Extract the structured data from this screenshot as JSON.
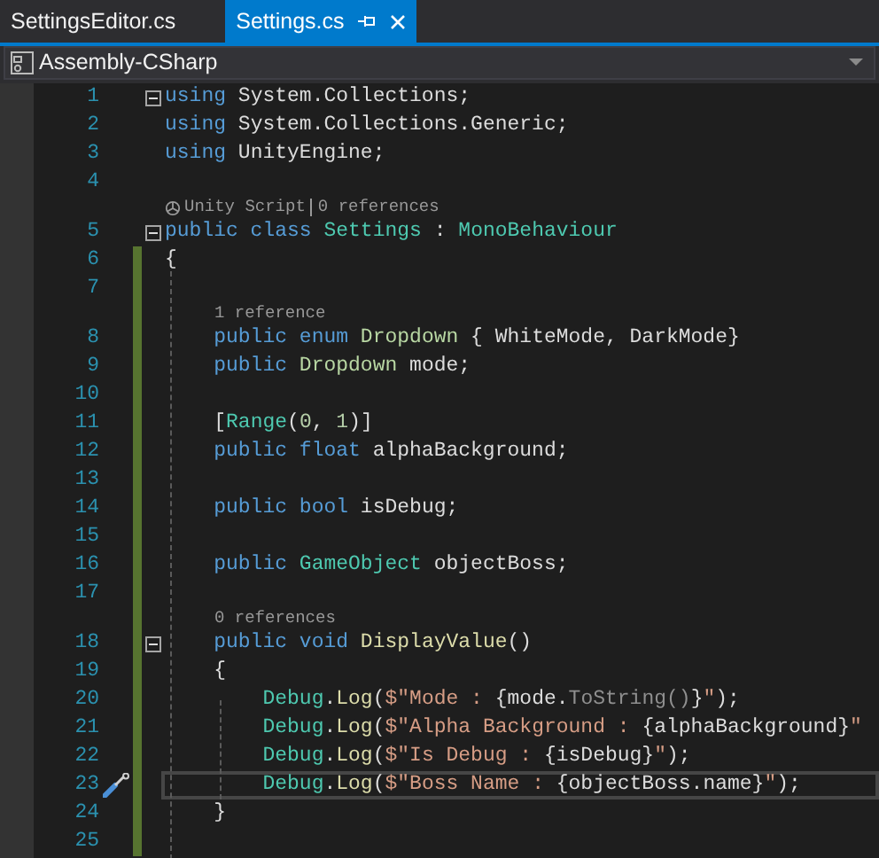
{
  "tabs": [
    {
      "label": "SettingsEditor.cs",
      "selected": false
    },
    {
      "label": "Settings.cs",
      "selected": true
    }
  ],
  "project_dropdown": {
    "value": "Assembly-CSharp"
  },
  "editor": {
    "lines": [
      {
        "number": "1",
        "fold": true,
        "changed": false,
        "current": false,
        "tokens": [
          {
            "kind": "kw",
            "text": "using"
          },
          {
            "kind": "plain",
            "text": " System.Collections;"
          }
        ]
      },
      {
        "number": "2",
        "fold": false,
        "changed": false,
        "current": false,
        "tokens": [
          {
            "kind": "kw",
            "text": "using"
          },
          {
            "kind": "plain",
            "text": " System.Collections.Generic;"
          }
        ]
      },
      {
        "number": "3",
        "fold": false,
        "changed": false,
        "current": false,
        "tokens": [
          {
            "kind": "kw",
            "text": "using"
          },
          {
            "kind": "plain",
            "text": " UnityEngine;"
          }
        ]
      },
      {
        "number": "4",
        "fold": false,
        "changed": false,
        "current": false
      },
      {
        "number": "5",
        "fold": true,
        "changed": false,
        "current": false,
        "lens": [
          {
            "kind": "unity",
            "text": "Unity Script"
          },
          {
            "kind": "refs",
            "text": "0 references"
          }
        ],
        "tokens": [
          {
            "kind": "kw",
            "text": "public class"
          },
          {
            "kind": "type",
            "text": " Settings"
          },
          {
            "kind": "plain",
            "text": " :"
          },
          {
            "kind": "type",
            "text": " MonoBehaviour"
          }
        ]
      },
      {
        "number": "6",
        "fold": false,
        "changed": true,
        "current": false,
        "tokens": [
          {
            "kind": "plain",
            "text": "{"
          }
        ]
      },
      {
        "number": "7",
        "fold": false,
        "changed": true,
        "current": false
      },
      {
        "number": "8",
        "fold": false,
        "changed": true,
        "current": false,
        "lens": [
          {
            "kind": "refs",
            "text": "1 reference"
          }
        ],
        "tokens": [
          {
            "kind": "kw",
            "text": "    public enum"
          },
          {
            "kind": "enum",
            "text": " Dropdown"
          },
          {
            "kind": "plain",
            "text": " { WhiteMode, DarkMode}"
          }
        ]
      },
      {
        "number": "9",
        "fold": false,
        "changed": true,
        "current": false,
        "tokens": [
          {
            "kind": "kw",
            "text": "    public"
          },
          {
            "kind": "enum",
            "text": " Dropdown"
          },
          {
            "kind": "plain",
            "text": " mode;"
          }
        ]
      },
      {
        "number": "10",
        "fold": false,
        "changed": true,
        "current": false
      },
      {
        "number": "11",
        "fold": false,
        "changed": true,
        "current": false,
        "tokens": [
          {
            "kind": "plain",
            "text": "    ["
          },
          {
            "kind": "type",
            "text": "Range"
          },
          {
            "kind": "plain",
            "text": "("
          },
          {
            "kind": "num",
            "text": "0"
          },
          {
            "kind": "plain",
            "text": ", "
          },
          {
            "kind": "num",
            "text": "1"
          },
          {
            "kind": "plain",
            "text": ")]"
          }
        ]
      },
      {
        "number": "12",
        "fold": false,
        "changed": true,
        "current": false,
        "tokens": [
          {
            "kind": "kw",
            "text": "    public float"
          },
          {
            "kind": "plain",
            "text": " alphaBackground;"
          }
        ]
      },
      {
        "number": "13",
        "fold": false,
        "changed": true,
        "current": false
      },
      {
        "number": "14",
        "fold": false,
        "changed": true,
        "current": false,
        "tokens": [
          {
            "kind": "kw",
            "text": "    public bool"
          },
          {
            "kind": "plain",
            "text": " isDebug;"
          }
        ]
      },
      {
        "number": "15",
        "fold": false,
        "changed": true,
        "current": false
      },
      {
        "number": "16",
        "fold": false,
        "changed": true,
        "current": false,
        "tokens": [
          {
            "kind": "kw",
            "text": "    public"
          },
          {
            "kind": "type",
            "text": " GameObject"
          },
          {
            "kind": "plain",
            "text": " objectBoss;"
          }
        ]
      },
      {
        "number": "17",
        "fold": false,
        "changed": true,
        "current": false
      },
      {
        "number": "18",
        "fold": true,
        "changed": true,
        "current": false,
        "lens": [
          {
            "kind": "refs",
            "text": "0 references"
          }
        ],
        "tokens": [
          {
            "kind": "kw",
            "text": "    public void"
          },
          {
            "kind": "method",
            "text": " DisplayValue"
          },
          {
            "kind": "plain",
            "text": "()"
          }
        ]
      },
      {
        "number": "19",
        "fold": false,
        "changed": true,
        "current": false,
        "tokens": [
          {
            "kind": "plain",
            "text": "    {"
          }
        ]
      },
      {
        "number": "20",
        "fold": false,
        "changed": true,
        "current": false,
        "tokens": [
          {
            "kind": "type",
            "text": "        Debug"
          },
          {
            "kind": "plain",
            "text": "."
          },
          {
            "kind": "method",
            "text": "Log"
          },
          {
            "kind": "plain",
            "text": "("
          },
          {
            "kind": "str",
            "text": "$\"Mode : "
          },
          {
            "kind": "plain",
            "text": "{mode."
          },
          {
            "kind": "dim",
            "text": "ToString()"
          },
          {
            "kind": "plain",
            "text": "}"
          },
          {
            "kind": "str",
            "text": "\""
          },
          {
            "kind": "plain",
            "text": ");"
          }
        ]
      },
      {
        "number": "21",
        "fold": false,
        "changed": true,
        "current": false,
        "tokens": [
          {
            "kind": "type",
            "text": "        Debug"
          },
          {
            "kind": "plain",
            "text": "."
          },
          {
            "kind": "method",
            "text": "Log"
          },
          {
            "kind": "plain",
            "text": "("
          },
          {
            "kind": "str",
            "text": "$\"Alpha Background : "
          },
          {
            "kind": "plain",
            "text": "{alphaBackground}"
          },
          {
            "kind": "str",
            "text": "\""
          }
        ]
      },
      {
        "number": "22",
        "fold": false,
        "changed": true,
        "current": false,
        "tokens": [
          {
            "kind": "type",
            "text": "        Debug"
          },
          {
            "kind": "plain",
            "text": "."
          },
          {
            "kind": "method",
            "text": "Log"
          },
          {
            "kind": "plain",
            "text": "("
          },
          {
            "kind": "str",
            "text": "$\"Is Debug : "
          },
          {
            "kind": "plain",
            "text": "{isDebug}"
          },
          {
            "kind": "str",
            "text": "\""
          },
          {
            "kind": "plain",
            "text": ");"
          }
        ]
      },
      {
        "number": "23",
        "fold": false,
        "changed": true,
        "current": true,
        "tokens": [
          {
            "kind": "type",
            "text": "        Debug"
          },
          {
            "kind": "plain",
            "text": "."
          },
          {
            "kind": "method",
            "text": "Log"
          },
          {
            "kind": "plain",
            "text": "("
          },
          {
            "kind": "str",
            "text": "$\"Boss Name : "
          },
          {
            "kind": "plain",
            "text": "{objectBoss.name}"
          },
          {
            "kind": "str",
            "text": "\""
          },
          {
            "kind": "plain",
            "text": ");"
          }
        ]
      },
      {
        "number": "24",
        "fold": false,
        "changed": true,
        "current": false,
        "tokens": [
          {
            "kind": "plain",
            "text": "    }"
          }
        ]
      },
      {
        "number": "25",
        "fold": false,
        "changed": true,
        "current": false
      }
    ]
  }
}
